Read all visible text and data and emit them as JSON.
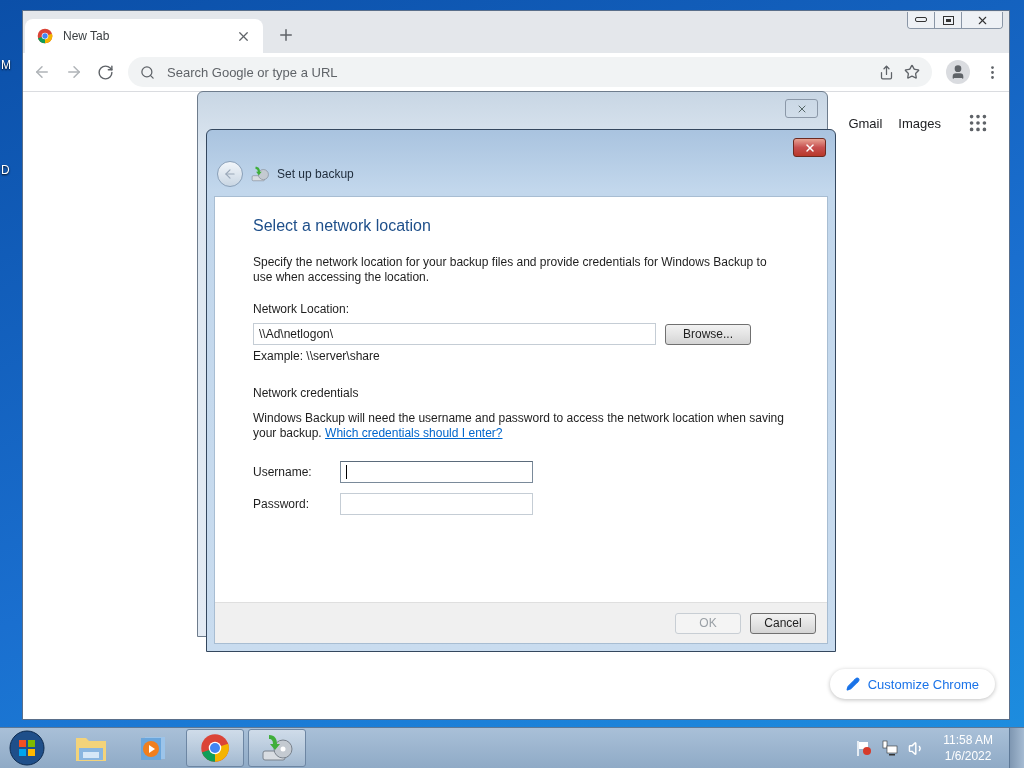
{
  "desktop": {
    "icon_labels": [
      "M",
      "D"
    ]
  },
  "browser": {
    "tabs": [
      {
        "title": "New Tab",
        "selected": true
      }
    ],
    "address_bar": {
      "placeholder": "Search Google or type a URL"
    },
    "links": [
      "Gmail",
      "Images"
    ],
    "customize_button": "Customize Chrome"
  },
  "dialog": {
    "title": "Set up backup",
    "heading": "Select a network location",
    "intro": "Specify the network location for your backup files and provide credentials for Windows Backup to use when accessing the location.",
    "location_label": "Network Location:",
    "location_value": "\\\\Ad\\netlogon\\",
    "browse_button": "Browse...",
    "example": "Example: \\\\server\\share",
    "credentials_heading": "Network credentials",
    "credentials_text": "Windows Backup will need the username and password to access the network location when saving your backup.",
    "credentials_link": "Which credentials should I enter?",
    "fields": [
      {
        "label": "Username:",
        "focused": true
      },
      {
        "label": "Password:",
        "focused": false
      }
    ],
    "buttons": [
      {
        "label": "OK",
        "disabled": true
      },
      {
        "label": "Cancel",
        "disabled": false
      }
    ]
  },
  "taskbar": {
    "apps": [
      {
        "kind": "explorer",
        "running": false
      },
      {
        "kind": "media",
        "running": false
      },
      {
        "kind": "chrome",
        "running": true
      },
      {
        "kind": "backup",
        "running": true
      }
    ],
    "clock": {
      "time": "11:58 AM",
      "date": "1/6/2022"
    }
  }
}
